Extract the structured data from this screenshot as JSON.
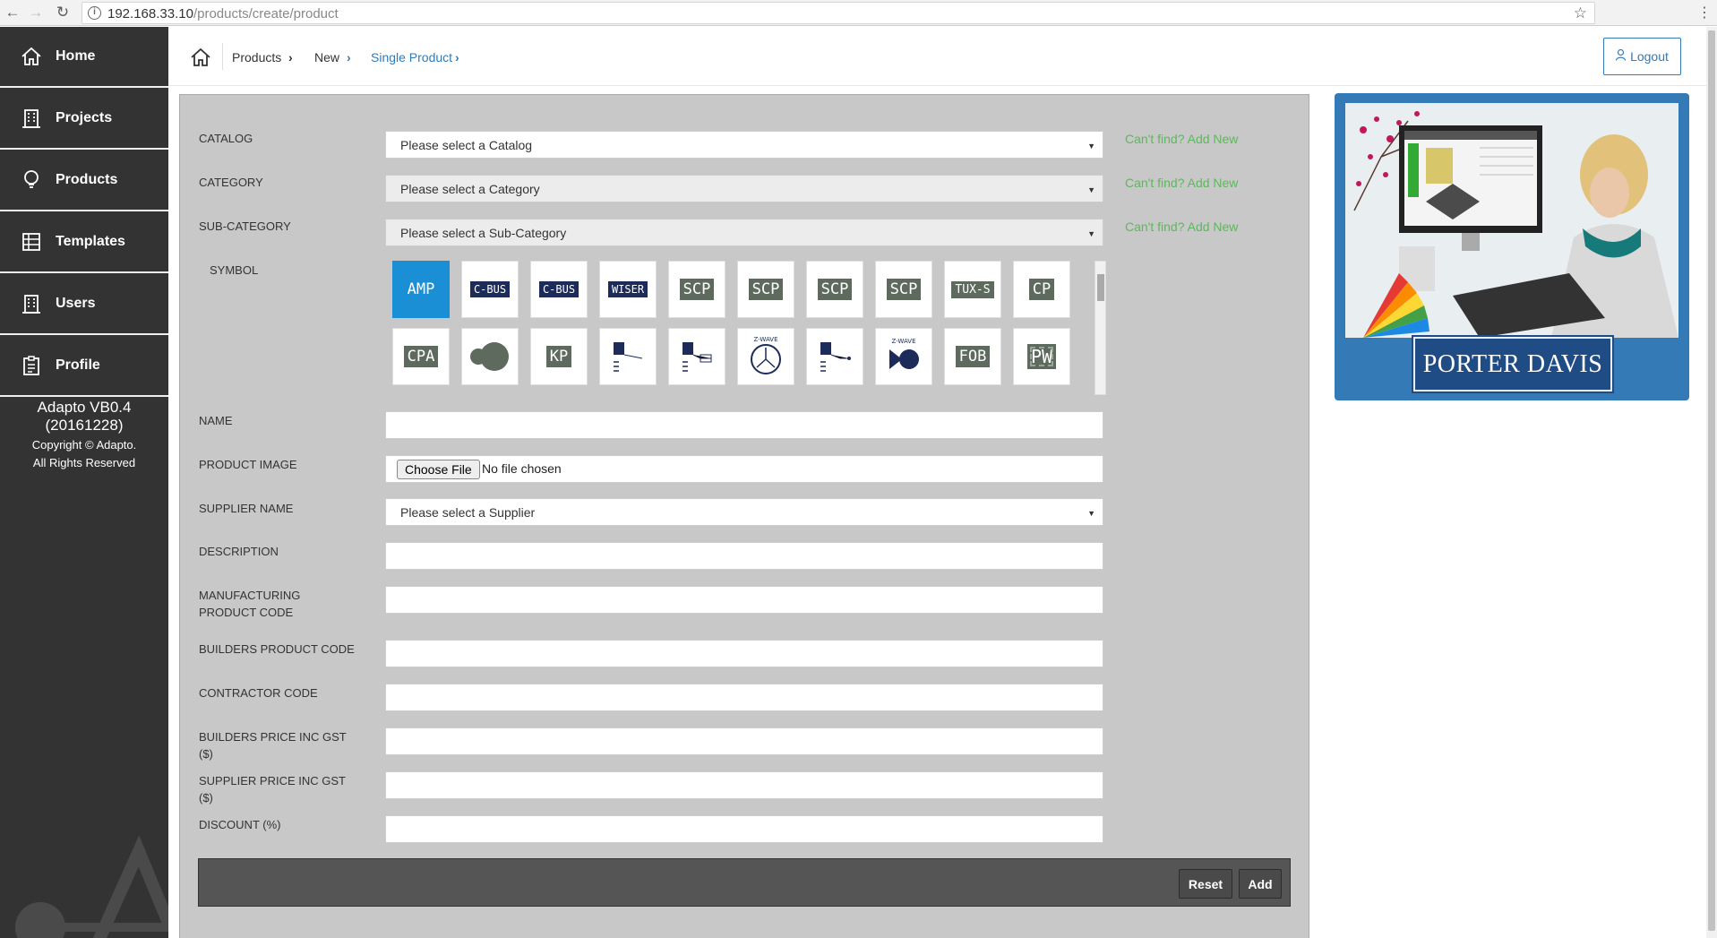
{
  "browser": {
    "url_host": "192.168.33.10",
    "url_path": "/products/create/product"
  },
  "sidebar": {
    "items": [
      {
        "label": "Home",
        "icon": "home-icon"
      },
      {
        "label": "Projects",
        "icon": "building-icon"
      },
      {
        "label": "Products",
        "icon": "lightbulb-icon"
      },
      {
        "label": "Templates",
        "icon": "template-icon"
      },
      {
        "label": "Users",
        "icon": "building-icon"
      },
      {
        "label": "Profile",
        "icon": "clipboard-icon"
      }
    ],
    "version": "Adapto VB0.4 (20161228)",
    "copyright_line1": "Copyright © Adapto.",
    "copyright_line2": "All Rights Reserved"
  },
  "header": {
    "breadcrumb": [
      "Products",
      "New",
      "Single Product"
    ],
    "logout_label": "Logout"
  },
  "form": {
    "catalog_label": "CATALOG",
    "catalog_value": "Please select a Catalog",
    "category_label": "CATEGORY",
    "category_value": "Please select a Category",
    "subcategory_label": "SUB-CATEGORY",
    "subcategory_value": "Please select a Sub-Category",
    "add_new_label": "Can't find? Add New",
    "symbol_label": "SYMBOL",
    "symbols": [
      "AMP",
      "C-BUS",
      "C-BUS",
      "WISER",
      "SCP",
      "SCP",
      "SCP",
      "SCP",
      "TUX-S",
      "CP",
      "CPA",
      "",
      "KP",
      "",
      "",
      "Z-WAVE",
      "",
      "Z-WAVE",
      "FOB",
      "PW"
    ],
    "name_label": "NAME",
    "name_value": "",
    "product_image_label": "PRODUCT IMAGE",
    "choose_file_label": "Choose File",
    "no_file_label": "No file chosen",
    "supplier_label": "SUPPLIER NAME",
    "supplier_value": "Please select a Supplier",
    "description_label": "DESCRIPTION",
    "mfg_code_label": "MANUFACTURING PRODUCT CODE",
    "builders_code_label": "BUILDERS PRODUCT CODE",
    "contractor_code_label": "CONTRACTOR CODE",
    "builders_price_label": "BUILDERS PRICE INC GST ($)",
    "supplier_price_label": "SUPPLIER PRICE INC GST ($)",
    "discount_label": "DISCOUNT (%)",
    "reset_label": "Reset",
    "add_label": "Add"
  },
  "promo": {
    "brand": "PORTER DAVIS"
  },
  "colors": {
    "sidebar_bg": "#333333",
    "accent": "#337ab7",
    "add_new": "#5cb85c",
    "selected_symbol": "#1a8fd6"
  }
}
